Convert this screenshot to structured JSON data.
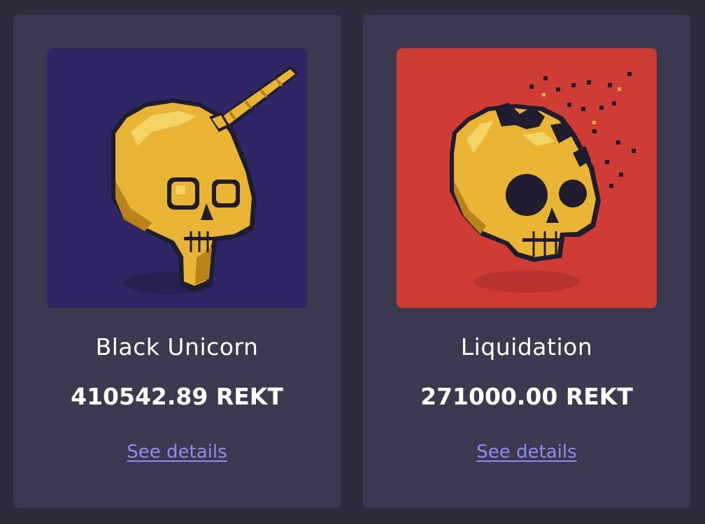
{
  "cards": [
    {
      "name": "Black Unicorn",
      "price": "410542.89 REKT",
      "link_label": "See details",
      "image_icon": "golden-skull-unicorn-horn-icon",
      "background_color": "#2f2765"
    },
    {
      "name": "Liquidation",
      "price": "271000.00 REKT",
      "link_label": "See details",
      "image_icon": "golden-skull-crumbling-icon",
      "background_color": "#cf3c34"
    }
  ],
  "colors": {
    "page_background": "#2c2b3c",
    "card_background": "#3b3950",
    "text": "#ffffff",
    "link": "#8f8cf2",
    "gold": "#e9b334",
    "gold_dark": "#b9831b",
    "outline": "#1f1c30"
  }
}
